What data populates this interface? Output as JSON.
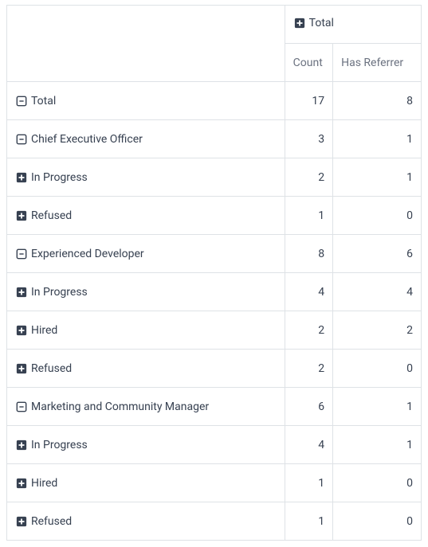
{
  "columns": {
    "group_label": "Total",
    "sub": [
      "Count",
      "Has Referrer"
    ]
  },
  "rows": [
    {
      "label": "Total",
      "level": 0,
      "expanded": true,
      "count": 17,
      "has_referrer": 8
    },
    {
      "label": "Chief Executive Officer",
      "level": 1,
      "expanded": true,
      "count": 3,
      "has_referrer": 1
    },
    {
      "label": "In Progress",
      "level": 2,
      "expanded": false,
      "count": 2,
      "has_referrer": 1
    },
    {
      "label": "Refused",
      "level": 2,
      "expanded": false,
      "count": 1,
      "has_referrer": 0
    },
    {
      "label": "Experienced Developer",
      "level": 1,
      "expanded": true,
      "count": 8,
      "has_referrer": 6
    },
    {
      "label": "In Progress",
      "level": 2,
      "expanded": false,
      "count": 4,
      "has_referrer": 4
    },
    {
      "label": "Hired",
      "level": 2,
      "expanded": false,
      "count": 2,
      "has_referrer": 2
    },
    {
      "label": "Refused",
      "level": 2,
      "expanded": false,
      "count": 2,
      "has_referrer": 0
    },
    {
      "label": "Marketing and Community Manager",
      "level": 1,
      "expanded": true,
      "count": 6,
      "has_referrer": 1
    },
    {
      "label": "In Progress",
      "level": 2,
      "expanded": false,
      "count": 4,
      "has_referrer": 1
    },
    {
      "label": "Hired",
      "level": 2,
      "expanded": false,
      "count": 1,
      "has_referrer": 0
    },
    {
      "label": "Refused",
      "level": 2,
      "expanded": false,
      "count": 1,
      "has_referrer": 0
    }
  ]
}
